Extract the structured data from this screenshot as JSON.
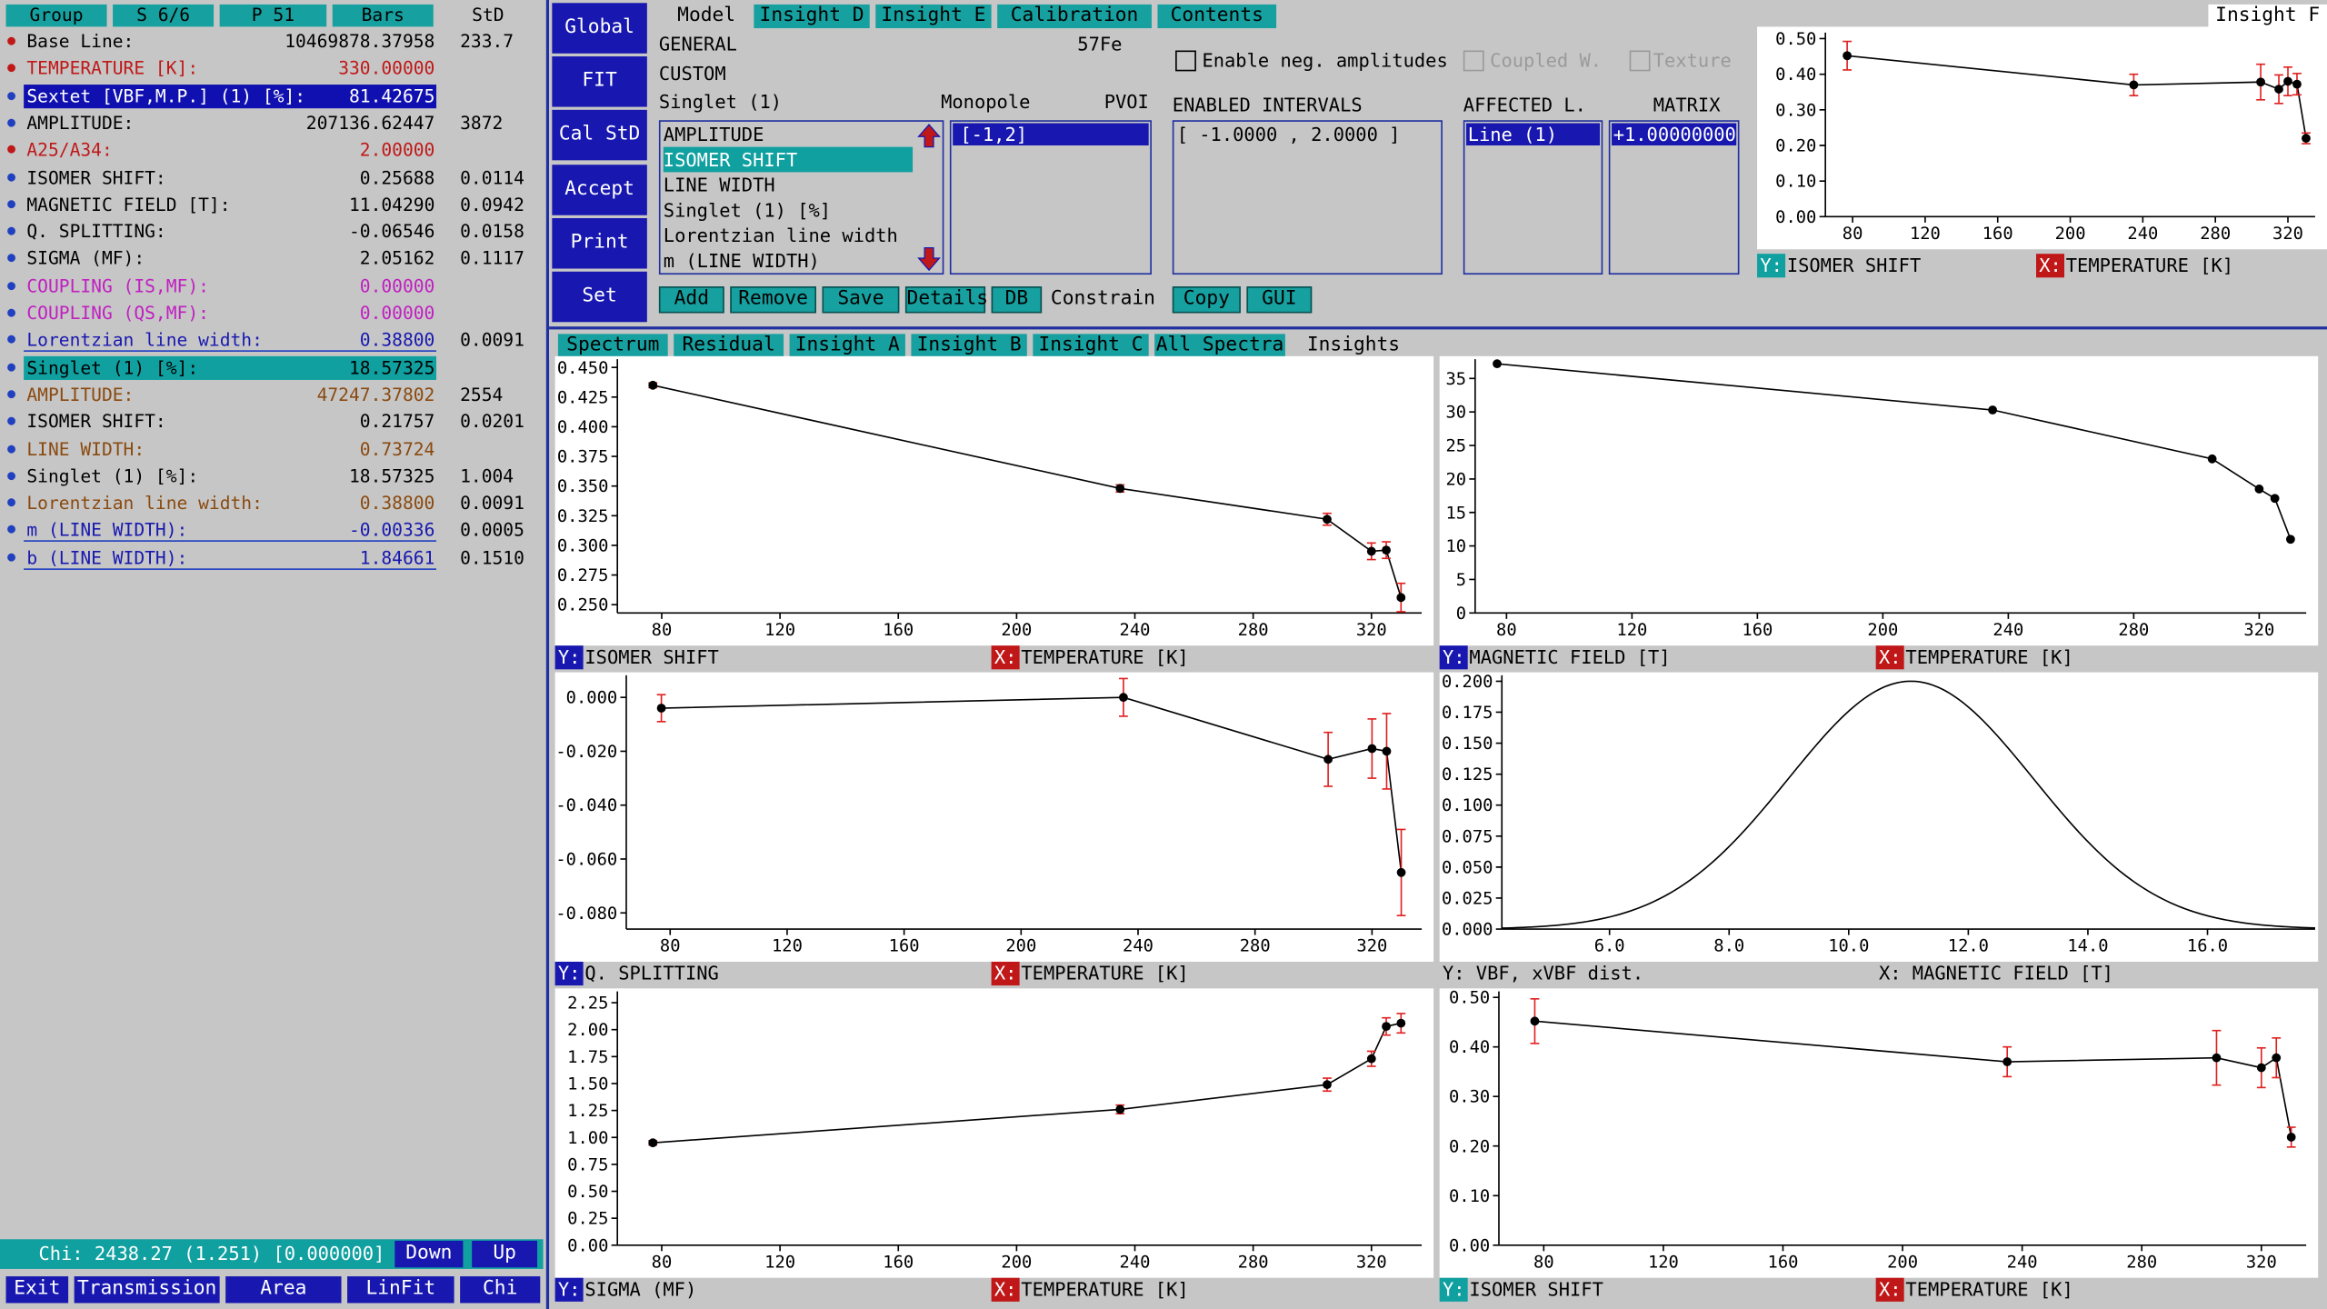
{
  "left": {
    "headers": {
      "group": "Group",
      "s": "S 6/6",
      "p": "P 51",
      "bars": "Bars",
      "std": "StD"
    },
    "rows": [
      {
        "name": "Base Line:",
        "value": "10469878.37958",
        "std": "233.7",
        "bullet": "#c01818",
        "color": "#000000",
        "hl": "none"
      },
      {
        "name": "TEMPERATURE [K]:",
        "value": "330.00000",
        "std": "",
        "bullet": "#c01818",
        "color": "#c01818",
        "hl": "none"
      },
      {
        "name": "Sextet [VBF,M.P.] (1) [%]:",
        "value": "81.42675",
        "std": "",
        "bullet": "#2040c0",
        "color": "#ffffff",
        "hl": "blue"
      },
      {
        "name": "AMPLITUDE:",
        "value": "207136.62447",
        "std": "3872",
        "bullet": "#2040c0",
        "color": "#000000",
        "hl": "none"
      },
      {
        "name": "A25/A34:",
        "value": "2.00000",
        "std": "",
        "bullet": "#c01818",
        "color": "#c01818",
        "hl": "none"
      },
      {
        "name": "ISOMER SHIFT:",
        "value": "0.25688",
        "std": "0.0114",
        "bullet": "#2040c0",
        "color": "#000000",
        "hl": "none"
      },
      {
        "name": "MAGNETIC FIELD [T]:",
        "value": "11.04290",
        "std": "0.0942",
        "bullet": "#2040c0",
        "color": "#000000",
        "hl": "none"
      },
      {
        "name": "Q. SPLITTING:",
        "value": "-0.06546",
        "std": "0.0158",
        "bullet": "#2040c0",
        "color": "#000000",
        "hl": "none"
      },
      {
        "name": "SIGMA (MF):",
        "value": "2.05162",
        "std": "0.1117",
        "bullet": "#2040c0",
        "color": "#000000",
        "hl": "none"
      },
      {
        "name": "COUPLING (IS,MF):",
        "value": "0.00000",
        "std": "",
        "bullet": "#2040c0",
        "color": "#c020c0",
        "hl": "none"
      },
      {
        "name": "COUPLING (QS,MF):",
        "value": "0.00000",
        "std": "",
        "bullet": "#2040c0",
        "color": "#c020c0",
        "hl": "none"
      },
      {
        "name": "Lorentzian line width:",
        "value": "0.38800",
        "std": "0.0091",
        "bullet": "#2040c0",
        "color": "#1818b0",
        "hl": "line"
      },
      {
        "name": "Singlet (1) [%]:",
        "value": "18.57325",
        "std": "",
        "bullet": "#2040c0",
        "color": "#000000",
        "hl": "teal"
      },
      {
        "name": "AMPLITUDE:",
        "value": "47247.37802",
        "std": "2554",
        "bullet": "#2040c0",
        "color": "#8a4a10",
        "hl": "none"
      },
      {
        "name": "ISOMER SHIFT:",
        "value": "0.21757",
        "std": "0.0201",
        "bullet": "#2040c0",
        "color": "#000000",
        "hl": "none"
      },
      {
        "name": "LINE WIDTH:",
        "value": "0.73724",
        "std": "",
        "bullet": "#2040c0",
        "color": "#8a4a10",
        "hl": "none"
      },
      {
        "name": "Singlet (1) [%]:",
        "value": "18.57325",
        "std": "1.004",
        "bullet": "#2040c0",
        "color": "#000000",
        "hl": "none"
      },
      {
        "name": "Lorentzian line width:",
        "value": "0.38800",
        "std": "0.0091",
        "bullet": "#2040c0",
        "color": "#8a4a10",
        "hl": "none"
      },
      {
        "name": "m (LINE WIDTH):",
        "value": "-0.00336",
        "std": "0.0005",
        "bullet": "#2040c0",
        "color": "#1818b0",
        "hl": "line"
      },
      {
        "name": "b (LINE WIDTH):",
        "value": "1.84661",
        "std": "0.1510",
        "bullet": "#2040c0",
        "color": "#1818b0",
        "hl": "line"
      }
    ],
    "chi": "Chi: 2438.27 (1.251) [0.000000]",
    "down": "Down",
    "up": "Up",
    "bottom_buttons": {
      "exit": "Exit",
      "transmission": "Transmission",
      "area": "Area",
      "linfit": "LinFit",
      "chi": "Chi"
    }
  },
  "side_buttons": {
    "global": "Global",
    "fit": "FIT",
    "calstd": "Cal StD",
    "accept": "Accept",
    "print": "Print",
    "set": "Set"
  },
  "top_tabs": {
    "model": "Model",
    "insight_d": "Insight D",
    "insight_e": "Insight E",
    "calibration": "Calibration",
    "contents": "Contents",
    "insight_f": "Insight F"
  },
  "model": {
    "general": "GENERAL",
    "isotope": "57Fe",
    "custom": "CUSTOM",
    "singlet": "Singlet (1)",
    "monopole": "Monopole",
    "pvoi": "PVOI",
    "param_list": [
      "AMPLITUDE",
      "ISOMER SHIFT",
      "LINE WIDTH",
      "Singlet (1) [%]",
      "Lorentzian line width",
      "m (LINE WIDTH)"
    ],
    "range_value": "[-1,2]",
    "enable_neg": "Enable neg. amplitudes",
    "coupled": "Coupled W.",
    "texture": "Texture",
    "enabled_intervals": "ENABLED INTERVALS",
    "interval_value": "[ -1.0000 , 2.0000 ]",
    "affected": "AFFECTED L.",
    "matrix": "MATRIX",
    "affected_value": "Line (1)",
    "matrix_value": "+1.00000000",
    "buttons": {
      "add": "Add",
      "remove": "Remove",
      "save": "Save",
      "details": "Details",
      "db": "DB",
      "constrain": "Constrain",
      "copy": "Copy",
      "gui": "GUI"
    }
  },
  "mid_tabs": {
    "spectrum": "Spectrum",
    "residual": "Residual",
    "insight_a": "Insight A",
    "insight_b": "Insight B",
    "insight_c": "Insight C",
    "all_spectra": "All Spectra",
    "insights": "Insights"
  },
  "colors": {
    "panel_bg": "#c6c6c6",
    "teal": "#17a0a0",
    "blue": "#1818b0",
    "red": "#c01818",
    "err": "#e02020"
  },
  "plots": {
    "f": {
      "y_label": "ISOMER SHIFT",
      "x_label": "TEMPERATURE [K]",
      "chart_data": {
        "type": "scatter",
        "x": [
          77,
          235,
          305,
          315,
          320,
          325,
          330
        ],
        "y": [
          0.452,
          0.37,
          0.378,
          0.358,
          0.38,
          0.372,
          0.22
        ],
        "err": [
          0.04,
          0.03,
          0.05,
          0.04,
          0.04,
          0.03,
          0.015
        ],
        "xlim": [
          65,
          335
        ],
        "ylim": [
          0.0,
          0.5
        ],
        "xticks": [
          80,
          120,
          160,
          200,
          240,
          280,
          320
        ],
        "yticks": [
          0.0,
          0.1,
          0.2,
          0.3,
          0.4,
          0.5
        ],
        "ytick_labels": [
          "0.00",
          "0.10",
          "0.20",
          "0.30",
          "0.40",
          "0.50"
        ]
      }
    },
    "a": {
      "y_label": "ISOMER SHIFT",
      "x_label": "TEMPERATURE [K]",
      "chart_data": {
        "type": "scatter",
        "x": [
          77,
          235,
          305,
          320,
          325,
          330
        ],
        "y": [
          0.435,
          0.348,
          0.322,
          0.295,
          0.296,
          0.256
        ],
        "err": [
          0.002,
          0.003,
          0.005,
          0.007,
          0.007,
          0.012
        ],
        "xlim": [
          65,
          337
        ],
        "ylim": [
          0.243,
          0.452
        ],
        "xticks": [
          80,
          120,
          160,
          200,
          240,
          280,
          320
        ],
        "yticks": [
          0.25,
          0.275,
          0.3,
          0.325,
          0.35,
          0.375,
          0.4,
          0.425,
          0.45
        ],
        "ytick_labels": [
          "0.250",
          "0.275",
          "0.300",
          "0.325",
          "0.350",
          "0.375",
          "0.400",
          "0.425",
          "0.450"
        ]
      }
    },
    "b": {
      "y_label": "MAGNETIC FIELD [T]",
      "x_label": "TEMPERATURE [K]",
      "chart_data": {
        "type": "scatter",
        "x": [
          77,
          235,
          305,
          320,
          325,
          330
        ],
        "y": [
          37.2,
          30.3,
          23.0,
          18.5,
          17.1,
          11.0
        ],
        "err": [
          0,
          0,
          0,
          0,
          0,
          0
        ],
        "xlim": [
          70,
          335
        ],
        "ylim": [
          0,
          37
        ],
        "xticks": [
          80,
          120,
          160,
          200,
          240,
          280,
          320
        ],
        "yticks": [
          0,
          5,
          10,
          15,
          20,
          25,
          30,
          35
        ],
        "ytick_labels": [
          "0",
          "5",
          "10",
          "15",
          "20",
          "25",
          "30",
          "35"
        ]
      }
    },
    "c": {
      "y_label": "Q. SPLITTING",
      "x_label": "TEMPERATURE [K]",
      "chart_data": {
        "type": "scatter",
        "x": [
          77,
          235,
          305,
          320,
          325,
          330
        ],
        "y": [
          -0.004,
          0.0,
          -0.023,
          -0.019,
          -0.02,
          -0.065
        ],
        "err": [
          0.005,
          0.007,
          0.01,
          0.011,
          0.014,
          0.016
        ],
        "xlim": [
          65,
          337
        ],
        "ylim": [
          -0.086,
          0.006
        ],
        "xticks": [
          80,
          120,
          160,
          200,
          240,
          280,
          320
        ],
        "yticks": [
          0.0,
          -0.02,
          -0.04,
          -0.06,
          -0.08
        ],
        "ytick_labels": [
          "0.000",
          "-0.020",
          "-0.040",
          "-0.060",
          "-0.080"
        ]
      }
    },
    "d": {
      "y_label": "VBF, xVBF dist.",
      "x_label": "MAGNETIC FIELD [T]",
      "chart_data": {
        "type": "line",
        "mean": 11.04,
        "sigma": 2.05,
        "peak": 0.2,
        "xlim": [
          4.2,
          17.8
        ],
        "ylim": [
          0,
          0.2
        ],
        "xticks": [
          6,
          8,
          10,
          12,
          14,
          16
        ],
        "xtick_labels": [
          "6.0",
          "8.0",
          "10.0",
          "12.0",
          "14.0",
          "16.0"
        ],
        "yticks": [
          0,
          0.025,
          0.05,
          0.075,
          0.1,
          0.125,
          0.15,
          0.175,
          0.2
        ],
        "ytick_labels": [
          "0.000",
          "0.025",
          "0.050",
          "0.075",
          "0.100",
          "0.125",
          "0.150",
          "0.175",
          "0.200"
        ]
      }
    },
    "e": {
      "y_label": "SIGMA (MF)",
      "x_label": "TEMPERATURE [K]",
      "chart_data": {
        "type": "scatter",
        "x": [
          77,
          235,
          305,
          320,
          325,
          330
        ],
        "y": [
          0.95,
          1.26,
          1.49,
          1.73,
          2.03,
          2.06
        ],
        "err": [
          0.02,
          0.04,
          0.06,
          0.07,
          0.08,
          0.09
        ],
        "xlim": [
          65,
          337
        ],
        "ylim": [
          0,
          2.3
        ],
        "xticks": [
          80,
          120,
          160,
          200,
          240,
          280,
          320
        ],
        "yticks": [
          0,
          0.25,
          0.5,
          0.75,
          1,
          1.25,
          1.5,
          1.75,
          2,
          2.25
        ],
        "ytick_labels": [
          "0.00",
          "0.25",
          "0.50",
          "0.75",
          "1.00",
          "1.25",
          "1.50",
          "1.75",
          "2.00",
          "2.25"
        ]
      }
    },
    "g": {
      "y_label": "ISOMER SHIFT",
      "x_label": "TEMPERATURE [K]",
      "chart_data": {
        "type": "scatter",
        "x": [
          77,
          235,
          305,
          320,
          325,
          330
        ],
        "y": [
          0.452,
          0.37,
          0.378,
          0.358,
          0.378,
          0.218
        ],
        "err": [
          0.045,
          0.03,
          0.055,
          0.04,
          0.04,
          0.02
        ],
        "xlim": [
          65,
          335
        ],
        "ylim": [
          0,
          0.5
        ],
        "xticks": [
          80,
          120,
          160,
          200,
          240,
          280,
          320
        ],
        "yticks": [
          0,
          0.1,
          0.2,
          0.3,
          0.4,
          0.5
        ],
        "ytick_labels": [
          "0.00",
          "0.10",
          "0.20",
          "0.30",
          "0.40",
          "0.50"
        ]
      }
    }
  }
}
